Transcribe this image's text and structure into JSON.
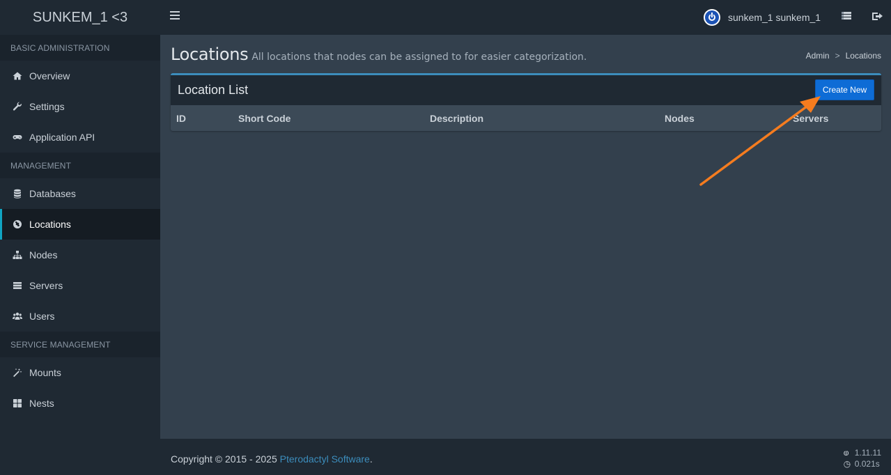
{
  "brand": "SUNKEM_1 <3",
  "user": {
    "name": "sunkem_1 sunkem_1"
  },
  "sidebar": {
    "sections": [
      {
        "header": "BASIC ADMINISTRATION",
        "items": [
          {
            "label": "Overview",
            "icon": "home-icon"
          },
          {
            "label": "Settings",
            "icon": "wrench-icon"
          },
          {
            "label": "Application API",
            "icon": "gamepad-icon"
          }
        ]
      },
      {
        "header": "MANAGEMENT",
        "items": [
          {
            "label": "Databases",
            "icon": "database-icon"
          },
          {
            "label": "Locations",
            "icon": "globe-icon",
            "active": true
          },
          {
            "label": "Nodes",
            "icon": "sitemap-icon"
          },
          {
            "label": "Servers",
            "icon": "server-icon"
          },
          {
            "label": "Users",
            "icon": "users-icon"
          }
        ]
      },
      {
        "header": "SERVICE MANAGEMENT",
        "items": [
          {
            "label": "Mounts",
            "icon": "magic-icon"
          },
          {
            "label": "Nests",
            "icon": "th-large-icon"
          }
        ]
      }
    ]
  },
  "page": {
    "title": "Locations",
    "subtitle": "All locations that nodes can be assigned to for easier categorization.",
    "breadcrumb": [
      "Admin",
      "Locations"
    ],
    "breadcrumb_sep": ">"
  },
  "box": {
    "title": "Location List",
    "create_label": "Create New",
    "columns": [
      "ID",
      "Short Code",
      "Description",
      "Nodes",
      "Servers"
    ]
  },
  "footer": {
    "copyright_prefix": "Copyright © 2015 - 2025 ",
    "copyright_link": "Pterodactyl Software",
    "copyright_suffix": ".",
    "version": "1.11.11",
    "time": "0.021s"
  },
  "colors": {
    "accent": "#3c8dbc",
    "button": "#0e6cd6",
    "active_bar": "#10a4c2",
    "annotation_arrow": "#f57c1f"
  }
}
